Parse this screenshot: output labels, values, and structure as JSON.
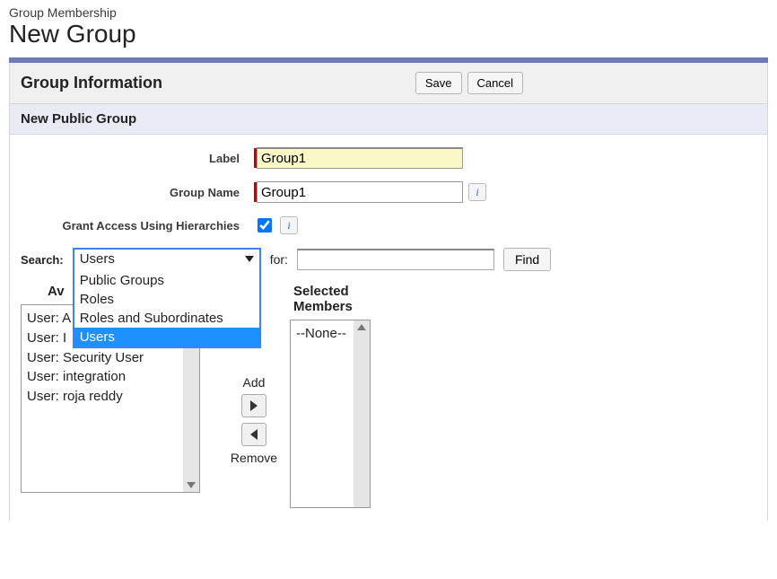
{
  "breadcrumb": "Group Membership",
  "page_title": "New Group",
  "section": {
    "title": "Group Information",
    "save_label": "Save",
    "cancel_label": "Cancel"
  },
  "subheader": "New Public Group",
  "form": {
    "label_field": {
      "label": "Label",
      "value": "Group1"
    },
    "name_field": {
      "label": "Group Name",
      "value": "Group1"
    },
    "hierarchies": {
      "label": "Grant Access Using Hierarchies",
      "checked": true
    },
    "info_glyph": "i"
  },
  "search": {
    "label": "Search:",
    "selected": "Users",
    "options": [
      "Public Groups",
      "Roles",
      "Roles and Subordinates",
      "Users"
    ],
    "for_label": "for:",
    "for_value": "",
    "find_label": "Find"
  },
  "lists": {
    "available_label": "Available Members",
    "available_label_truncated": "Av",
    "available_items": [
      "User: A",
      "User: I",
      "User: Security User",
      "User: integration",
      "User: roja reddy"
    ],
    "available_items_truncated_top": [
      "User: ",
      "User: "
    ],
    "selected_label": "Selected Members",
    "selected_items": [
      "--None--"
    ],
    "add_label": "Add",
    "remove_label": "Remove"
  }
}
